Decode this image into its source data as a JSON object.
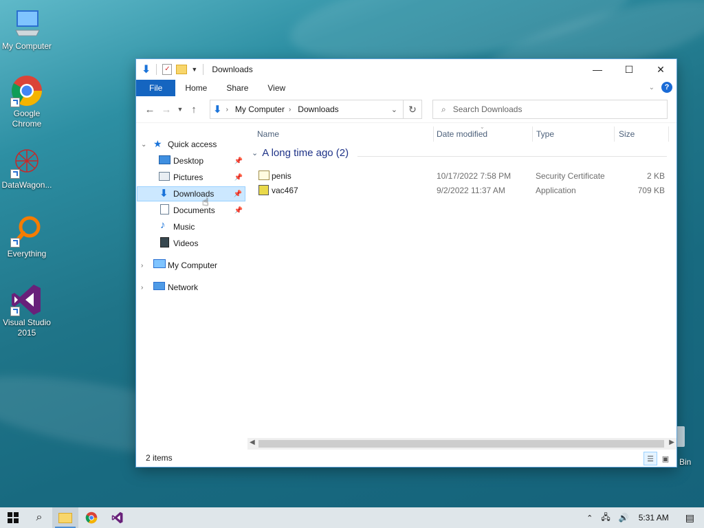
{
  "desktop": {
    "icons": [
      {
        "label": "My Computer"
      },
      {
        "label": "Google Chrome"
      },
      {
        "label": "DataWagon..."
      },
      {
        "label": "Everything"
      },
      {
        "label": "Visual Studio 2015"
      }
    ],
    "recycle_bin_label": "Bin"
  },
  "window": {
    "title": "Downloads",
    "controls": {
      "minimize": "—",
      "maximize": "☐",
      "close": "✕"
    },
    "ribbon_tabs": [
      "File",
      "Home",
      "Share",
      "View"
    ],
    "address": {
      "crumbs": [
        "My Computer",
        "Downloads"
      ]
    },
    "search": {
      "placeholder": "Search Downloads"
    },
    "nav": {
      "quick_access": "Quick access",
      "items": [
        {
          "label": "Desktop",
          "pinned": true
        },
        {
          "label": "Pictures",
          "pinned": true
        },
        {
          "label": "Downloads",
          "pinned": true,
          "selected": true
        },
        {
          "label": "Documents",
          "pinned": true
        },
        {
          "label": "Music",
          "pinned": false
        },
        {
          "label": "Videos",
          "pinned": false
        }
      ],
      "my_computer": "My Computer",
      "network": "Network"
    },
    "columns": [
      "Name",
      "Date modified",
      "Type",
      "Size"
    ],
    "group_label": "A long time ago (2)",
    "files": [
      {
        "name": "penis",
        "date": "10/17/2022 7:58 PM",
        "type": "Security Certificate",
        "size": "2 KB",
        "icon": "certificate-icon"
      },
      {
        "name": "vac467",
        "date": "9/2/2022 11:37 AM",
        "type": "Application",
        "size": "709 KB",
        "icon": "application-icon"
      }
    ],
    "status": {
      "item_count": "2 items"
    }
  },
  "taskbar": {
    "clock": "5:31 AM"
  },
  "colors": {
    "accent": "#1565c0",
    "selection": "#cce8ff",
    "group_text": "#1e3287"
  }
}
